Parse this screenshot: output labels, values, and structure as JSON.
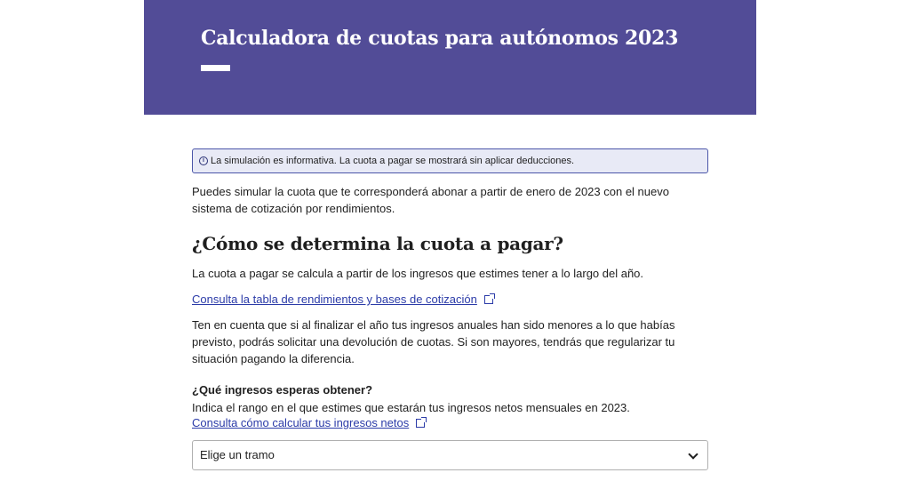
{
  "header": {
    "title": "Calculadora de cuotas para autónomos 2023"
  },
  "alert": {
    "icon": "info-icon",
    "text": "La simulación es informativa. La cuota a pagar se mostrará sin aplicar deducciones."
  },
  "intro": {
    "text": "Puedes simular la cuota que te corresponderá abonar a partir de enero de 2023 con el nuevo sistema de cotización por rendimientos."
  },
  "section": {
    "heading": "¿Cómo se determina la cuota a pagar?",
    "paragraph1": "La cuota a pagar se calcula a partir de los ingresos que estimes tener a lo largo del año.",
    "link1": "Consulta la tabla de rendimientos y bases de cotización",
    "paragraph2": "Ten en cuenta que si al finalizar el año tus ingresos anuales han sido menores a lo que habías previsto, podrás solicitar una devolución de cuotas. Si son mayores, tendrás que regularizar tu situación pagando la diferencia."
  },
  "form": {
    "label": "¿Qué ingresos esperas obtener?",
    "hint": "Indica el rango en el que estimes que estarán tus ingresos netos mensuales en 2023.",
    "link": "Consulta cómo calcular tus ingresos netos",
    "select_value": "Elige un tramo"
  },
  "colors": {
    "hero_background": "#524c97",
    "link": "#2b3ba8",
    "alert_border": "#4a55a8",
    "alert_background": "#e8eaf6"
  }
}
